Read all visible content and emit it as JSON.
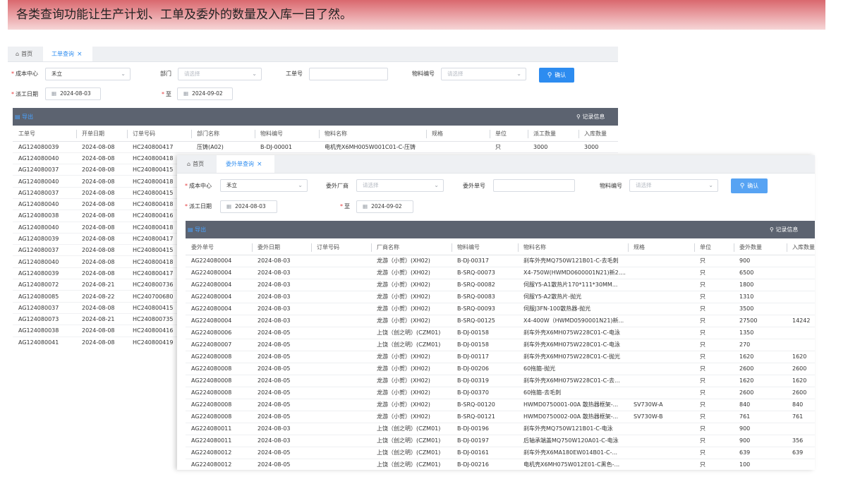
{
  "banner": {
    "text": "各类查询功能让生产计划、工单及委外的数量及入库一目了然。"
  },
  "panel1": {
    "tabs": {
      "home": "首页",
      "active": "工单查询"
    },
    "filters": {
      "cost_center_label": "成本中心",
      "cost_center_value": "禾立",
      "dept_label": "部门",
      "dept_placeholder": "请选择",
      "order_no_label": "工单号",
      "order_no_value": "",
      "material_label": "物料编号",
      "material_placeholder": "请选择",
      "confirm_label": "确认",
      "date_label": "派工日期",
      "date_from": "2024-08-03",
      "to_label": "至",
      "date_to": "2024-09-02"
    },
    "toolbar": {
      "export_label": "导出",
      "record_label": "记录信息"
    },
    "columns": [
      "工单号",
      "开单日期",
      "订单号码",
      "部门名称",
      "物料编号",
      "物料名称",
      "规格",
      "单位",
      "派工数量",
      "入库数量"
    ],
    "rows": [
      [
        "AG124080039",
        "2024-08-08",
        "HC240800417",
        "压铸(A02)",
        "B-DJ-00001",
        "电机壳X6MH005W001C01-C-压铸",
        "",
        "只",
        "3000",
        "3000"
      ],
      [
        "AG124080040",
        "2024-08-08",
        "HC240800418",
        "",
        "",
        "",
        "",
        "",
        "",
        ""
      ],
      [
        "AG124080037",
        "2024-08-08",
        "HC240800415",
        "",
        "",
        "",
        "",
        "",
        "",
        ""
      ],
      [
        "AG124080040",
        "2024-08-08",
        "HC240800418",
        "",
        "",
        "",
        "",
        "",
        "",
        ""
      ],
      [
        "AG124080037",
        "2024-08-08",
        "HC240800415",
        "",
        "",
        "",
        "",
        "",
        "",
        ""
      ],
      [
        "AG124080040",
        "2024-08-08",
        "HC240800418",
        "",
        "",
        "",
        "",
        "",
        "",
        ""
      ],
      [
        "AG124080038",
        "2024-08-08",
        "HC240800416",
        "",
        "",
        "",
        "",
        "",
        "",
        ""
      ],
      [
        "AG124080040",
        "2024-08-08",
        "HC240800418",
        "",
        "",
        "",
        "",
        "",
        "",
        ""
      ],
      [
        "AG124080039",
        "2024-08-08",
        "HC240800417",
        "",
        "",
        "",
        "",
        "",
        "",
        ""
      ],
      [
        "AG124080037",
        "2024-08-08",
        "HC240800415",
        "",
        "",
        "",
        "",
        "",
        "",
        ""
      ],
      [
        "AG124080040",
        "2024-08-08",
        "HC240800418",
        "",
        "",
        "",
        "",
        "",
        "",
        ""
      ],
      [
        "AG124080039",
        "2024-08-08",
        "HC240800417",
        "",
        "",
        "",
        "",
        "",
        "",
        ""
      ],
      [
        "AG124080072",
        "2024-08-21",
        "HC240800736",
        "",
        "",
        "",
        "",
        "",
        "",
        ""
      ],
      [
        "AG124080085",
        "2024-08-22",
        "HC240700680",
        "",
        "",
        "",
        "",
        "",
        "",
        ""
      ],
      [
        "AG124080037",
        "2024-08-08",
        "HC240800415",
        "",
        "",
        "",
        "",
        "",
        "",
        ""
      ],
      [
        "AG124080073",
        "2024-08-21",
        "HC240800735",
        "",
        "",
        "",
        "",
        "",
        "",
        ""
      ],
      [
        "AG124080038",
        "2024-08-08",
        "HC240800416",
        "",
        "",
        "",
        "",
        "",
        "",
        ""
      ],
      [
        "AG124080041",
        "2024-08-08",
        "HC240800419",
        "",
        "",
        "",
        "",
        "",
        "",
        ""
      ]
    ]
  },
  "panel2": {
    "tabs": {
      "home": "首页",
      "active": "委外单查询"
    },
    "filters": {
      "cost_center_label": "成本中心",
      "cost_center_value": "禾立",
      "vendor_label": "委外厂商",
      "vendor_placeholder": "请选择",
      "order_no_label": "委外单号",
      "order_no_value": "",
      "material_label": "物料编号",
      "material_placeholder": "请选择",
      "confirm_label": "确认",
      "date_label": "派工日期",
      "date_from": "2024-08-03",
      "to_label": "至",
      "date_to": "2024-09-02"
    },
    "toolbar": {
      "export_label": "导出",
      "record_label": "记录信息"
    },
    "columns": [
      "委外单号",
      "委外日期",
      "订单号码",
      "厂商名称",
      "物料编号",
      "物料名称",
      "规格",
      "单位",
      "委外数量",
      "入库数量"
    ],
    "rows": [
      [
        "AG224080004",
        "2024-08-03",
        "",
        "龙游（小贺）(XH02)",
        "B-DJ-00317",
        "刹车外壳MQ750W121B01-C-去毛刺",
        "",
        "只",
        "900",
        ""
      ],
      [
        "AG224080004",
        "2024-08-03",
        "",
        "龙游（小贺）(XH02)",
        "B-SRQ-00073",
        "X4-750W(HWMD0600001N21)新2....",
        "",
        "只",
        "6500",
        ""
      ],
      [
        "AG224080004",
        "2024-08-03",
        "",
        "龙游（小贺）(XH02)",
        "B-SRQ-00082",
        "伺服Y5-A1散热片170*111*30MM...",
        "",
        "只",
        "1800",
        ""
      ],
      [
        "AG224080004",
        "2024-08-03",
        "",
        "龙游（小贺）(XH02)",
        "B-SRQ-00083",
        "伺服Y5-A2散热片-抛光",
        "",
        "只",
        "1310",
        ""
      ],
      [
        "AG224080004",
        "2024-08-03",
        "",
        "龙游（小贺）(XH02)",
        "B-SRQ-00093",
        "伺服J3FN-100散热器-抛光",
        "",
        "只",
        "3500",
        ""
      ],
      [
        "AG224080004",
        "2024-08-03",
        "",
        "龙游（小贺）(XH02)",
        "B-SRQ-00125",
        "X4-400W（HWMD0590001N21)新...",
        "",
        "只",
        "27500",
        "14242"
      ],
      [
        "AG224080006",
        "2024-08-05",
        "",
        "上饶（创之明）(CZM01)",
        "B-DJ-00158",
        "刹车外壳X6MH075W228C01-C-电泳",
        "",
        "只",
        "1350",
        ""
      ],
      [
        "AG224080007",
        "2024-08-05",
        "",
        "上饶（创之明）(CZM01)",
        "B-DJ-00158",
        "刹车外壳X6MH075W228C01-C-电泳",
        "",
        "只",
        "270",
        ""
      ],
      [
        "AG224080008",
        "2024-08-05",
        "",
        "龙游（小贺）(XH02)",
        "B-DJ-00117",
        "刹车外壳X6MH075W228C01-C-抛光",
        "",
        "只",
        "1620",
        "1620"
      ],
      [
        "AG224080008",
        "2024-08-05",
        "",
        "龙游（小贺）(XH02)",
        "B-DJ-00206",
        "60拖箍-抛光",
        "",
        "只",
        "2600",
        "2600"
      ],
      [
        "AG224080008",
        "2024-08-05",
        "",
        "龙游（小贺）(XH02)",
        "B-DJ-00319",
        "刹车外壳X6MH075W228C01-C-去...",
        "",
        "只",
        "1620",
        "1620"
      ],
      [
        "AG224080008",
        "2024-08-05",
        "",
        "龙游（小贺）(XH02)",
        "B-DJ-00370",
        "60拖箍-去毛刺",
        "",
        "只",
        "2600",
        "2600"
      ],
      [
        "AG224080008",
        "2024-08-05",
        "",
        "龙游（小贺）(XH02)",
        "B-SRQ-00120",
        "HWMD0750001-00A 散热器框架-...",
        "SV730W-A",
        "只",
        "840",
        "840"
      ],
      [
        "AG224080008",
        "2024-08-05",
        "",
        "龙游（小贺）(XH02)",
        "B-SRQ-00121",
        "HWMD0750002-00A 散热器框架-...",
        "SV730W-B",
        "只",
        "761",
        "761"
      ],
      [
        "AG224080011",
        "2024-08-03",
        "",
        "上饶（创之明）(CZM01)",
        "B-DJ-00196",
        "刹车外壳MQ750W121B01-C-电泳",
        "",
        "只",
        "900",
        ""
      ],
      [
        "AG224080011",
        "2024-08-03",
        "",
        "上饶（创之明）(CZM01)",
        "B-DJ-00197",
        "后轴承端盖MQ750W120A01-C-电泳",
        "",
        "只",
        "900",
        "356"
      ],
      [
        "AG224080012",
        "2024-08-05",
        "",
        "上饶（创之明）(CZM01)",
        "B-DJ-00161",
        "刹车外壳X6MA180EW014B01-C-...",
        "",
        "只",
        "639",
        "639"
      ],
      [
        "AG224080012",
        "2024-08-05",
        "",
        "上饶（创之明）(CZM01)",
        "B-DJ-00216",
        "电机壳X6MH075W012E01-C黑色-...",
        "",
        "只",
        "100",
        ""
      ]
    ]
  }
}
